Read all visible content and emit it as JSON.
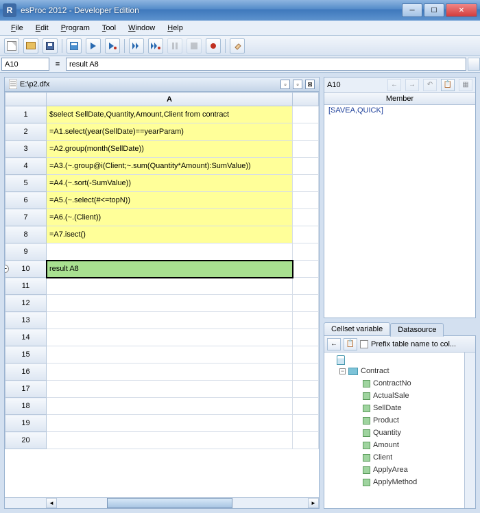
{
  "window": {
    "title": "esProc 2012 - Developer Edition",
    "icon_letter": "R"
  },
  "menu": [
    "File",
    "Edit",
    "Program",
    "Tool",
    "Window",
    "Help"
  ],
  "formulabar": {
    "cell": "A10",
    "value": "result A8"
  },
  "document": {
    "filename": "E:\\p2.dfx"
  },
  "grid": {
    "column": "A",
    "rows": [
      {
        "n": 1,
        "v": "$select SellDate,Quantity,Amount,Client from contract",
        "c": "yellow"
      },
      {
        "n": 2,
        "v": "=A1.select(year(SellDate)==yearParam)",
        "c": "yellow"
      },
      {
        "n": 3,
        "v": "=A2.group(month(SellDate))",
        "c": "yellow"
      },
      {
        "n": 4,
        "v": "=A3.(~.group@i(Client;~.sum(Quantity*Amount):SumValue))",
        "c": "yellow"
      },
      {
        "n": 5,
        "v": "=A4.(~.sort(-SumValue))",
        "c": "yellow"
      },
      {
        "n": 6,
        "v": "=A5.(~.select(#<=topN))",
        "c": "yellow"
      },
      {
        "n": 7,
        "v": "=A6.(~.(Client))",
        "c": "yellow"
      },
      {
        "n": 8,
        "v": "=A7.isect()",
        "c": "yellow"
      },
      {
        "n": 9,
        "v": "",
        "c": ""
      },
      {
        "n": 10,
        "v": "result A8",
        "c": "green",
        "selected": true,
        "collapse": true
      },
      {
        "n": 11,
        "v": "",
        "c": ""
      },
      {
        "n": 12,
        "v": "",
        "c": ""
      },
      {
        "n": 13,
        "v": "",
        "c": ""
      },
      {
        "n": 14,
        "v": "",
        "c": ""
      },
      {
        "n": 15,
        "v": "",
        "c": ""
      },
      {
        "n": 16,
        "v": "",
        "c": ""
      },
      {
        "n": 17,
        "v": "",
        "c": ""
      },
      {
        "n": 18,
        "v": "",
        "c": ""
      },
      {
        "n": 19,
        "v": "",
        "c": ""
      },
      {
        "n": 20,
        "v": "",
        "c": ""
      }
    ]
  },
  "right": {
    "cell": "A10",
    "member_header": "Member",
    "member_value": "[SAVEA,QUICK]"
  },
  "tabs": {
    "cellset": "Cellset variable",
    "datasource": "Datasource"
  },
  "datasource": {
    "prefix_label": "Prefix table name to col...",
    "table": "Contract",
    "fields": [
      "ContractNo",
      "ActualSale",
      "SellDate",
      "Product",
      "Quantity",
      "Amount",
      "Client",
      "ApplyArea",
      "ApplyMethod"
    ]
  }
}
